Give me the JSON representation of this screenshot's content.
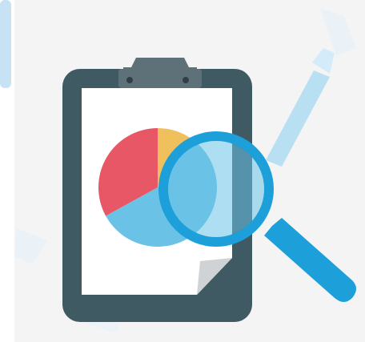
{
  "illustration": {
    "colors": {
      "background_panel": "#f4f4f4",
      "edge_accent": "#c7e2f5",
      "faint_decor": "#dcecf8",
      "board": "#3f5a63",
      "paper": "#ffffff",
      "paper_fold": "#d0d3d5",
      "clip": "#5f7178",
      "clip_hole": "#2f3f45",
      "pie_red": "#e85765",
      "pie_yellow": "#f0c05c",
      "pie_blue": "#6ac3e6",
      "lens_tint": "#6ac3e6",
      "magnifier": "#1d9fda",
      "ray": "#b9dff3"
    },
    "icons": [
      "clipboard-icon",
      "pie-chart-icon",
      "magnifying-glass-icon"
    ],
    "pie_chart": {
      "slices": [
        {
          "name": "red",
          "fraction": 0.33
        },
        {
          "name": "yellow",
          "fraction": 0.1
        },
        {
          "name": "blue",
          "fraction": 0.57
        }
      ]
    }
  }
}
